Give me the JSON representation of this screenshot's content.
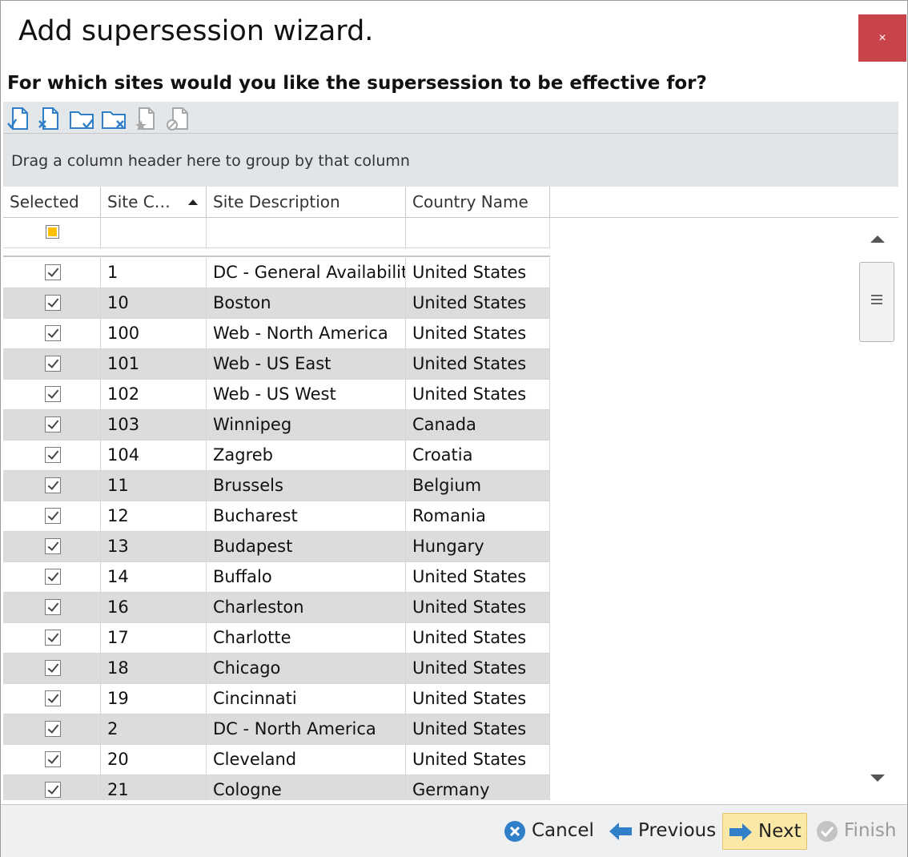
{
  "window": {
    "title": "Add supersession wizard.",
    "close_glyph": "×"
  },
  "question": "For which sites would you like the supersession to be effective for?",
  "toolbar": {
    "icons": [
      "select-page-icon",
      "deselect-page-icon",
      "select-all-icon",
      "deselect-all-icon",
      "favorite-icon",
      "clear-icon"
    ]
  },
  "group_panel": {
    "text": "Drag a column header here to group by that column"
  },
  "grid": {
    "columns": [
      "Selected",
      "Site C…",
      "Site Description",
      "Country Name"
    ],
    "sorted_column": "Site C…",
    "sort_direction": "ascending",
    "filter_selected_state": "indeterminate",
    "rows": [
      {
        "selected": true,
        "code": "1",
        "description": "DC - General Availability",
        "country": "United States"
      },
      {
        "selected": true,
        "code": "10",
        "description": "Boston",
        "country": "United States"
      },
      {
        "selected": true,
        "code": "100",
        "description": "Web - North America",
        "country": "United States"
      },
      {
        "selected": true,
        "code": "101",
        "description": "Web - US East",
        "country": "United States"
      },
      {
        "selected": true,
        "code": "102",
        "description": "Web - US West",
        "country": "United States"
      },
      {
        "selected": true,
        "code": "103",
        "description": "Winnipeg",
        "country": "Canada"
      },
      {
        "selected": true,
        "code": "104",
        "description": "Zagreb",
        "country": "Croatia"
      },
      {
        "selected": true,
        "code": "11",
        "description": "Brussels",
        "country": "Belgium"
      },
      {
        "selected": true,
        "code": "12",
        "description": "Bucharest",
        "country": "Romania"
      },
      {
        "selected": true,
        "code": "13",
        "description": "Budapest",
        "country": "Hungary"
      },
      {
        "selected": true,
        "code": "14",
        "description": "Buffalo",
        "country": "United States"
      },
      {
        "selected": true,
        "code": "16",
        "description": "Charleston",
        "country": "United States"
      },
      {
        "selected": true,
        "code": "17",
        "description": "Charlotte",
        "country": "United States"
      },
      {
        "selected": true,
        "code": "18",
        "description": "Chicago",
        "country": "United States"
      },
      {
        "selected": true,
        "code": "19",
        "description": "Cincinnati",
        "country": "United States"
      },
      {
        "selected": true,
        "code": "2",
        "description": "DC - North America",
        "country": "United States"
      },
      {
        "selected": true,
        "code": "20",
        "description": "Cleveland",
        "country": "United States"
      },
      {
        "selected": true,
        "code": "21",
        "description": "Cologne",
        "country": "Germany"
      }
    ]
  },
  "footer": {
    "cancel_label": "Cancel",
    "previous_label": "Previous",
    "next_label": "Next",
    "finish_label": "Finish"
  },
  "colors": {
    "close_button": "#c9434a",
    "alt_row": "#dcdcdc",
    "icon_blue": "#2f7fc9",
    "next_highlight": "#fbe8a6",
    "indeterminate_checkbox": "#ffbf00"
  }
}
